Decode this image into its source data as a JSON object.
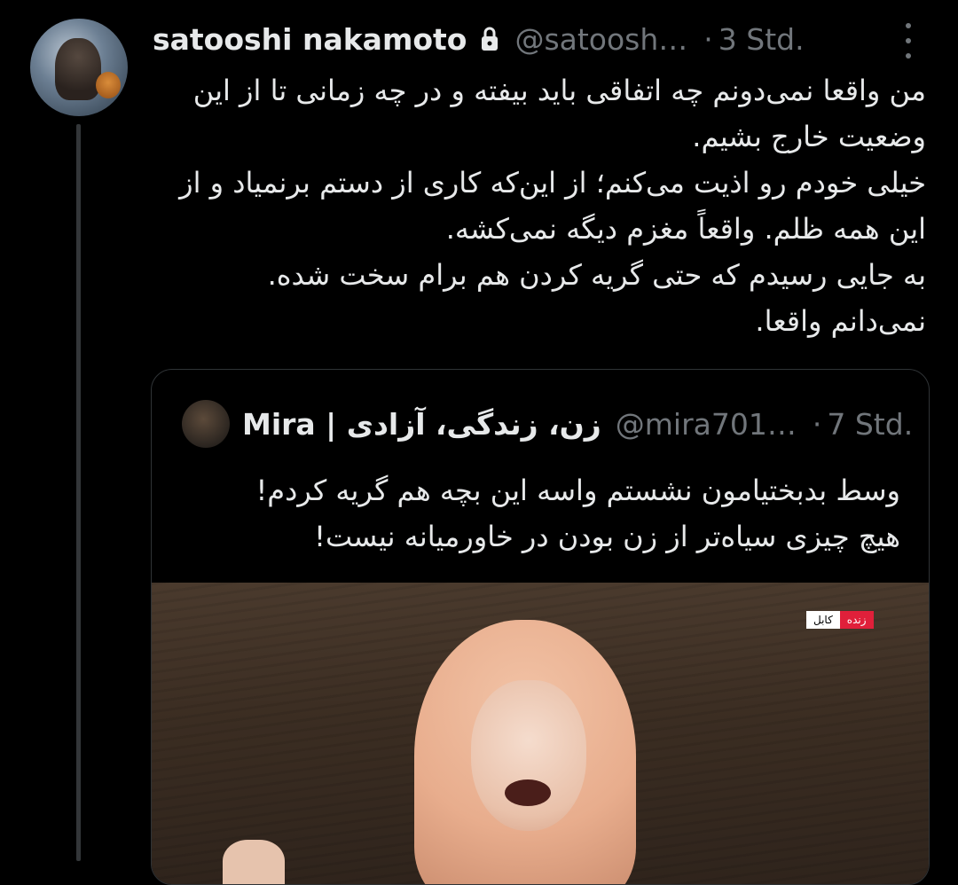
{
  "tweet": {
    "author_name": "satooshi nakamoto",
    "handle": "@satoosh…",
    "separator": "·",
    "time": "3 Std.",
    "paragraphs": [
      "من واقعا نمی‌دونم چه اتفاقی باید بیفته و در چه زمانی تا از این وضعیت خارج بشیم.",
      "خیلی خودم رو اذیت می‌کنم؛ از این‌که کاری از دستم برنمیاد و از این همه ظلم. واقعاً مغزم دیگه نمی‌کشه.",
      "به جایی رسیدم که حتی گریه کردن هم برام سخت شده.",
      "نمی‌دانم واقعا."
    ]
  },
  "quoted": {
    "author_name": "Mira | زن، زندگی، آزادی",
    "handle": "@mira701…",
    "separator": "·",
    "time": "7 Std.",
    "paragraphs": [
      "وسط بدبختیامون نشستم واسه این بچه هم گریه کردم!",
      "هیچ چیزی سیاه‌تر از زن بودن در خاورمیانه نیست!"
    ],
    "media": {
      "location_label": "کابل",
      "live_label": "زنده"
    }
  },
  "icons": {
    "lock": "lock-icon",
    "more": "more-vertical-icon"
  },
  "colors": {
    "background": "#000000",
    "text": "#e7e9ea",
    "muted": "#71767b",
    "border": "#2f3336",
    "live": "#e0203a"
  }
}
